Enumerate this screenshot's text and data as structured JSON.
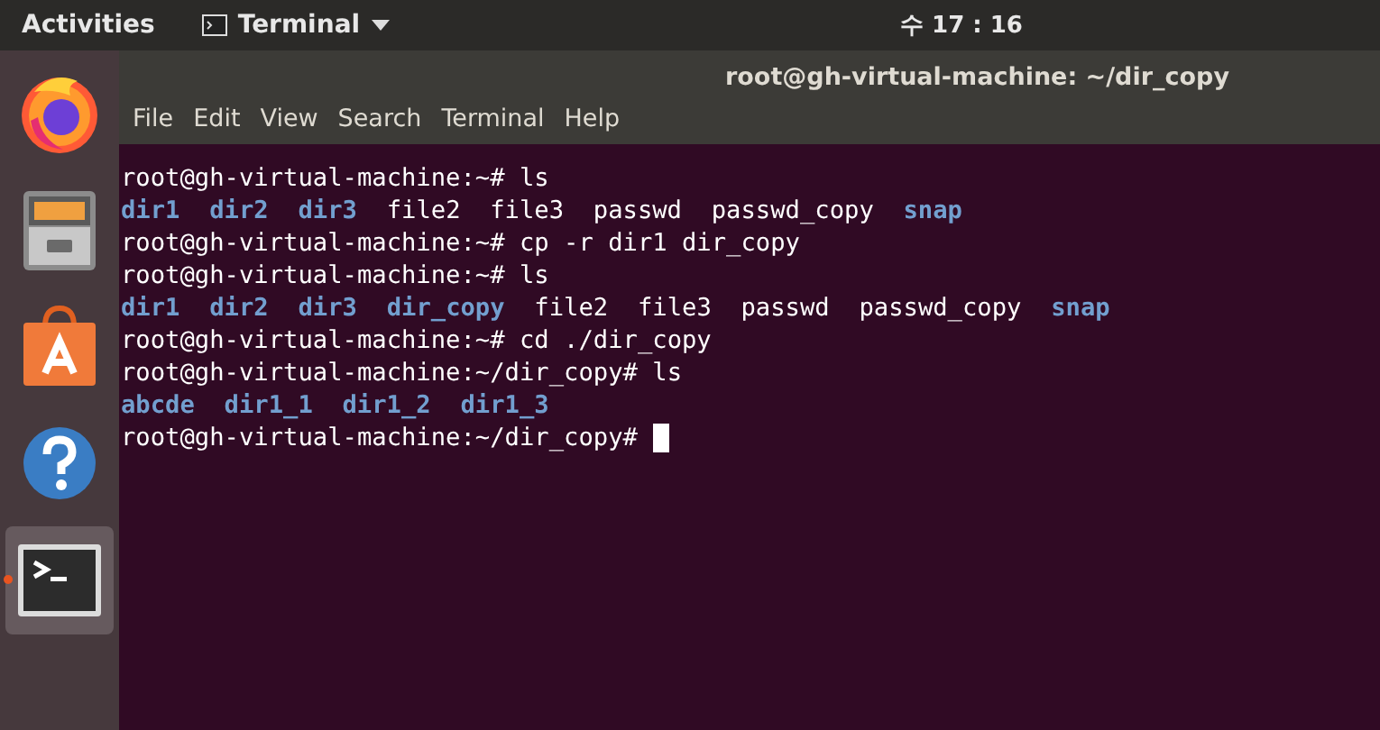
{
  "top_bar": {
    "activities": "Activities",
    "app_menu": "Terminal",
    "clock": "수 17 : 16"
  },
  "dock": [
    {
      "kind": "browser",
      "selected": false,
      "running": false
    },
    {
      "kind": "files",
      "selected": false,
      "running": false
    },
    {
      "kind": "store",
      "selected": false,
      "running": false
    },
    {
      "kind": "help",
      "selected": false,
      "running": false
    },
    {
      "kind": "terminal",
      "selected": true,
      "running": true
    }
  ],
  "window": {
    "title": "root@gh-virtual-machine: ~/dir_copy",
    "menu": [
      "File",
      "Edit",
      "View",
      "Search",
      "Terminal",
      "Help"
    ]
  },
  "terminal": {
    "lines": [
      [
        {
          "kind": "text",
          "text": "root@gh-virtual-machine:~# ls"
        }
      ],
      [
        {
          "kind": "dir",
          "text": "dir1"
        },
        {
          "kind": "dir",
          "text": "dir2"
        },
        {
          "kind": "dir",
          "text": "dir3"
        },
        {
          "kind": "file",
          "text": "file2"
        },
        {
          "kind": "file",
          "text": "file3"
        },
        {
          "kind": "file",
          "text": "passwd"
        },
        {
          "kind": "file",
          "text": "passwd_copy"
        },
        {
          "kind": "dir",
          "text": "snap"
        }
      ],
      [
        {
          "kind": "text",
          "text": "root@gh-virtual-machine:~# cp -r dir1 dir_copy"
        }
      ],
      [
        {
          "kind": "text",
          "text": "root@gh-virtual-machine:~# ls"
        }
      ],
      [
        {
          "kind": "dir",
          "text": "dir1"
        },
        {
          "kind": "dir",
          "text": "dir2"
        },
        {
          "kind": "dir",
          "text": "dir3"
        },
        {
          "kind": "dir",
          "text": "dir_copy"
        },
        {
          "kind": "file",
          "text": "file2"
        },
        {
          "kind": "file",
          "text": "file3"
        },
        {
          "kind": "file",
          "text": "passwd"
        },
        {
          "kind": "file",
          "text": "passwd_copy"
        },
        {
          "kind": "dir",
          "text": "snap"
        }
      ],
      [
        {
          "kind": "text",
          "text": "root@gh-virtual-machine:~# cd ./dir_copy"
        }
      ],
      [
        {
          "kind": "text",
          "text": "root@gh-virtual-machine:~/dir_copy# ls"
        }
      ],
      [
        {
          "kind": "dir",
          "text": "abcde"
        },
        {
          "kind": "dir",
          "text": "dir1_1"
        },
        {
          "kind": "dir",
          "text": "dir1_2"
        },
        {
          "kind": "dir",
          "text": "dir1_3"
        }
      ],
      [
        {
          "kind": "text",
          "text": "root@gh-virtual-machine:~/dir_copy#"
        },
        {
          "kind": "cursor"
        }
      ]
    ]
  }
}
